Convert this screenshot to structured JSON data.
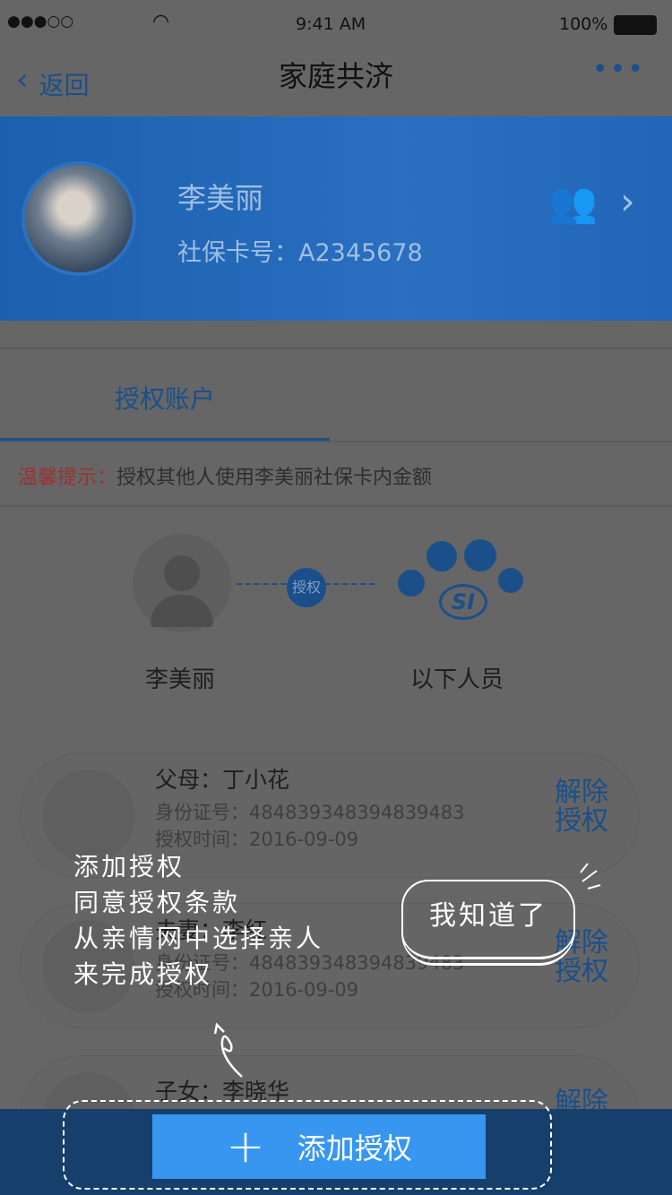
{
  "status_bar": {
    "signal": "●●●○○",
    "time": "9:41 AM",
    "battery": "100%"
  },
  "nav": {
    "back": "返回",
    "title": "家庭共济",
    "more": "•••"
  },
  "profile": {
    "name": "李美丽",
    "card_label": "社保卡号：",
    "card_no": "A2345678"
  },
  "tabs": [
    {
      "label": "授权账户"
    }
  ],
  "tip": {
    "label": "温馨提示：",
    "text": "授权其他人使用李美丽社保卡内金额"
  },
  "diagram": {
    "from": "李美丽",
    "badge": "授权",
    "to": "以下人员",
    "logo": "SI"
  },
  "members": [
    {
      "relation": "父母：丁小花",
      "id_label": "身份证号：",
      "id": "484839348394839483",
      "time_label": "授权时间：",
      "time": "2016-09-09",
      "action": "解除授权"
    },
    {
      "relation": "夫妻：李红",
      "id_label": "身份证号：",
      "id": "484839348394839483",
      "time_label": "授权时间：",
      "time": "2016-09-09",
      "action": "解除授权"
    },
    {
      "relation": "子女：李晓华",
      "action": "解除授权"
    }
  ],
  "guide": {
    "lines": [
      "添加授权",
      "同意授权条款",
      "从亲情网中选择亲人",
      "来完成授权"
    ],
    "dismiss": "我知道了"
  },
  "bottom": {
    "add_label": "添加授权",
    "plus": "+"
  }
}
